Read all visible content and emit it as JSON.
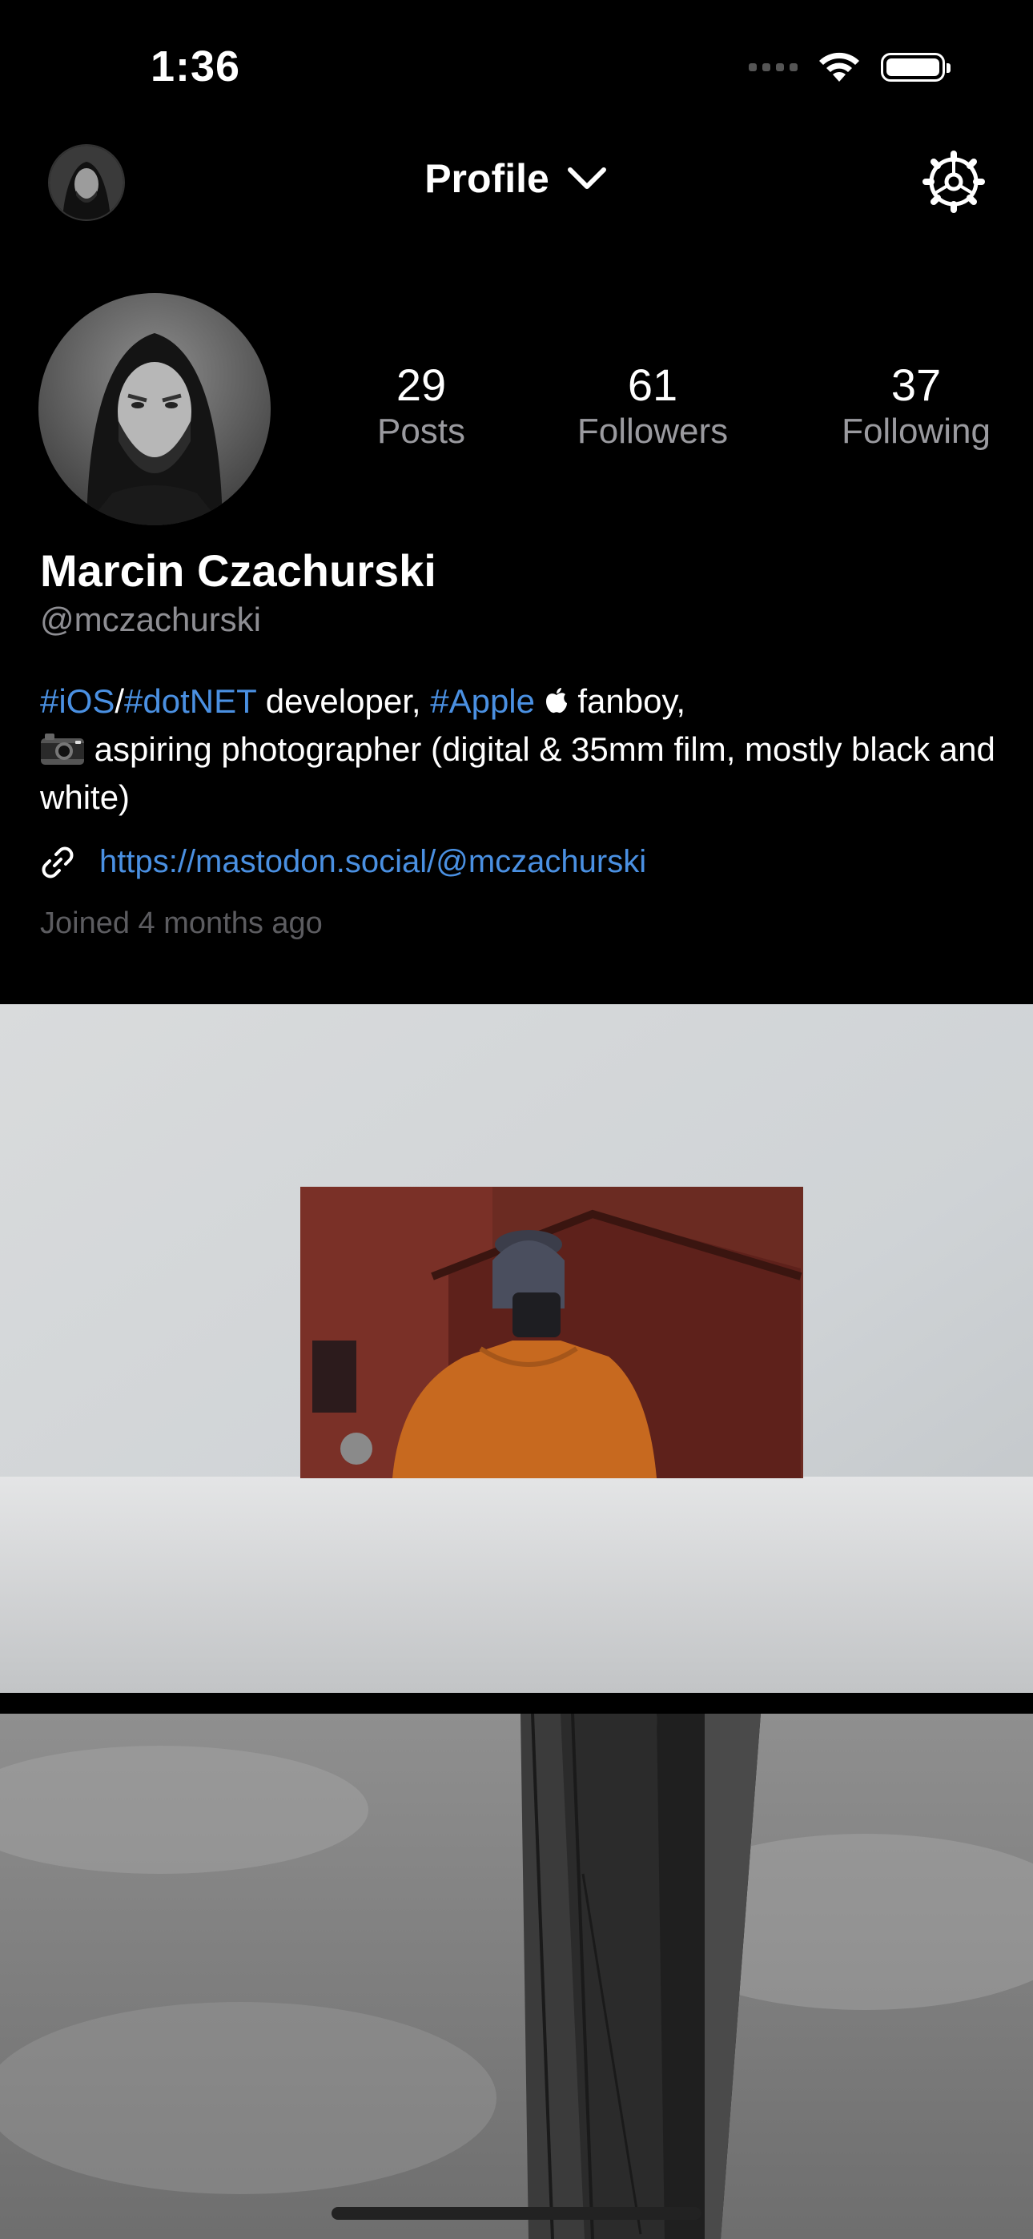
{
  "status_bar": {
    "time": "1:36"
  },
  "nav": {
    "title": "Profile",
    "icons": {
      "avatar": "user-avatar-icon",
      "chevron": "chevron-down-icon",
      "settings": "gear-icon"
    }
  },
  "profile": {
    "stats": [
      {
        "value": "29",
        "label": "Posts"
      },
      {
        "value": "61",
        "label": "Followers"
      },
      {
        "value": "37",
        "label": "Following"
      }
    ],
    "display_name": "Marcin Czachurski",
    "handle": "@mczachurski",
    "bio": {
      "tag_ios": "#iOS",
      "slash": "/",
      "tag_dotnet": "#dotNET",
      "text1": " developer, ",
      "tag_apple": "#Apple",
      "apple_glyph": "",
      "text2": " fanboy,",
      "camera_glyph": "📷",
      "text3": " aspiring photographer (digital & 35mm film, mostly black and white)"
    },
    "link": "https://mastodon.social/@mczachurski",
    "joined": "Joined 4 months ago"
  },
  "colors": {
    "accent": "#4a90e2",
    "background": "#000000",
    "secondary_text": "#9a9a9f"
  }
}
